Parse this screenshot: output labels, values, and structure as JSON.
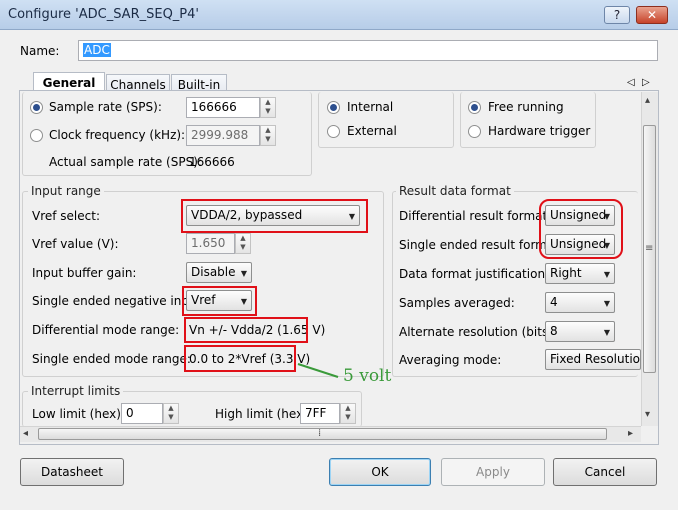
{
  "window": {
    "title": "Configure 'ADC_SAR_SEQ_P4'",
    "help_glyph": "?",
    "close_glyph": "✕"
  },
  "name_field": {
    "label": "Name:",
    "value": "ADC"
  },
  "tabs": [
    {
      "label": "General"
    },
    {
      "label": "Channels"
    },
    {
      "label": "Built-in"
    }
  ],
  "tab_nav": {
    "prev": "◁",
    "next": "▷"
  },
  "timing": {
    "sample_rate_label": "Sample rate (SPS):",
    "sample_rate_value": "166666",
    "clock_freq_label": "Clock frequency (kHz):",
    "clock_freq_value": "2999.988",
    "actual_rate_label": "Actual sample rate (SPS):",
    "actual_rate_value": "166666"
  },
  "clock_source": {
    "internal": "Internal",
    "external": "External"
  },
  "trigger": {
    "free_running": "Free running",
    "hardware": "Hardware trigger"
  },
  "input_range": {
    "title": "Input range",
    "vref_select_label": "Vref select:",
    "vref_select_value": "VDDA/2, bypassed",
    "vref_value_label": "Vref value (V):",
    "vref_value": "1.650",
    "buffer_gain_label": "Input buffer gain:",
    "buffer_gain_value": "Disable",
    "se_neg_input_label": "Single ended negative input:",
    "se_neg_input_value": "Vref",
    "diff_range_label": "Differential mode range:",
    "diff_range_value": "Vn +/- Vdda/2 (1.65 V)",
    "se_range_label": "Single ended mode range:",
    "se_range_value": "0.0 to 2*Vref (3.3 V)"
  },
  "annotation": {
    "text": "5 volt",
    "color": "#3a9a3a"
  },
  "result_format": {
    "title": "Result data format",
    "diff_format_label": "Differential result format:",
    "diff_format_value": "Unsigned",
    "se_format_label": "Single ended result format:",
    "se_format_value": "Unsigned",
    "justification_label": "Data format justification:",
    "justification_value": "Right",
    "samples_avg_label": "Samples averaged:",
    "samples_avg_value": "4",
    "alt_res_label": "Alternate resolution (bits):",
    "alt_res_value": "8",
    "avg_mode_label": "Averaging mode:",
    "avg_mode_value": "Fixed Resolution"
  },
  "interrupt": {
    "title": "Interrupt limits",
    "low_label": "Low limit (hex):",
    "low_value": "0",
    "high_label": "High limit (hex):",
    "high_value": "7FF"
  },
  "scroll": {
    "left": "◂",
    "right": "▸",
    "up": "▴",
    "down": "▾",
    "grip": "⁞",
    "vgrip": "≡"
  },
  "buttons": {
    "datasheet": "Datasheet",
    "ok": "OK",
    "apply": "Apply",
    "cancel": "Cancel"
  },
  "colors": {
    "highlight_border": "#e01018",
    "selection": "#3399ff"
  }
}
